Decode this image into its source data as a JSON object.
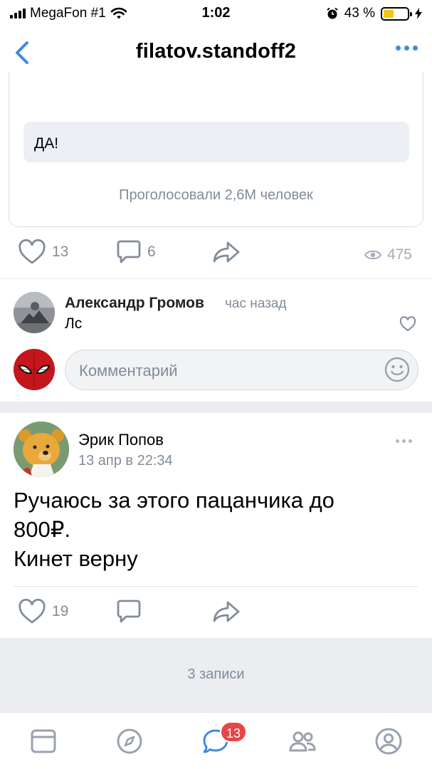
{
  "status_bar": {
    "carrier": "MegaFon #1",
    "time": "1:02",
    "battery_percent": "43 %",
    "battery_level": 0.43
  },
  "nav": {
    "title": "filatov.standoff2",
    "back_icon": "chevron-left-icon",
    "more_icon": "more-horizontal-icon"
  },
  "poll": {
    "option_label": "ДА!",
    "votes_text": "Проголосовали 2,6M человек"
  },
  "post1_actions": {
    "likes": "13",
    "comments": "6",
    "views": "475"
  },
  "comment": {
    "author": "Александр Громов",
    "time": "час назад",
    "text": "Лс"
  },
  "comment_input": {
    "placeholder": "Комментарий"
  },
  "post2": {
    "author": "Эрик Попов",
    "date": "13 апр в 22:34",
    "text_lines": [
      "Ручаюсь за этого пацанчика до",
      "800₽.",
      "Кинет верну"
    ],
    "likes": "19"
  },
  "feed_footer": {
    "count_text": "3 записи"
  },
  "tabbar": {
    "tabs": [
      "news-tab",
      "explore-tab",
      "messages-tab",
      "friends-tab",
      "profile-tab"
    ],
    "messages_badge": "13",
    "active_tab": "messages-tab"
  },
  "colors": {
    "accent": "#3f8ae0",
    "secondary_text": "#818c99",
    "badge": "#e64646",
    "separator_band": "#ebedf0"
  }
}
